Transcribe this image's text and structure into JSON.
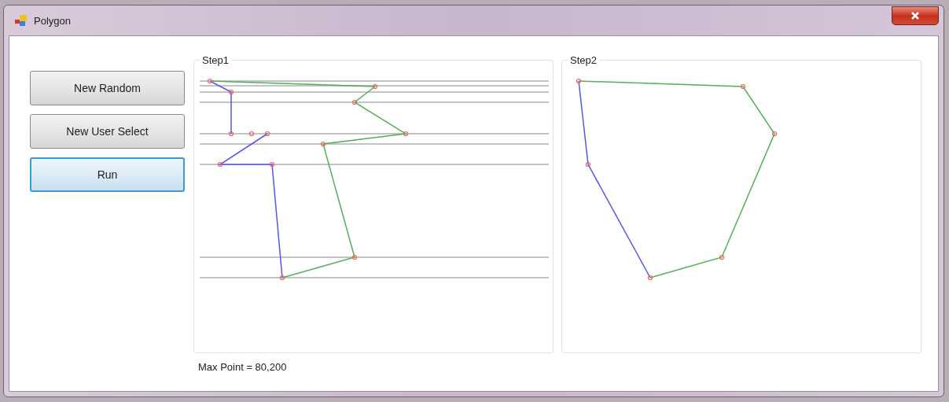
{
  "window": {
    "title": "Polygon"
  },
  "buttons": [
    {
      "label": "New Random",
      "focused": false
    },
    {
      "label": "New User Select",
      "focused": false
    },
    {
      "label": "Run",
      "focused": true
    }
  ],
  "panels": [
    {
      "title": "Step1",
      "kind": "sweep"
    },
    {
      "title": "Step2",
      "kind": "hull"
    }
  ],
  "status": "Max Point = 80,200"
}
